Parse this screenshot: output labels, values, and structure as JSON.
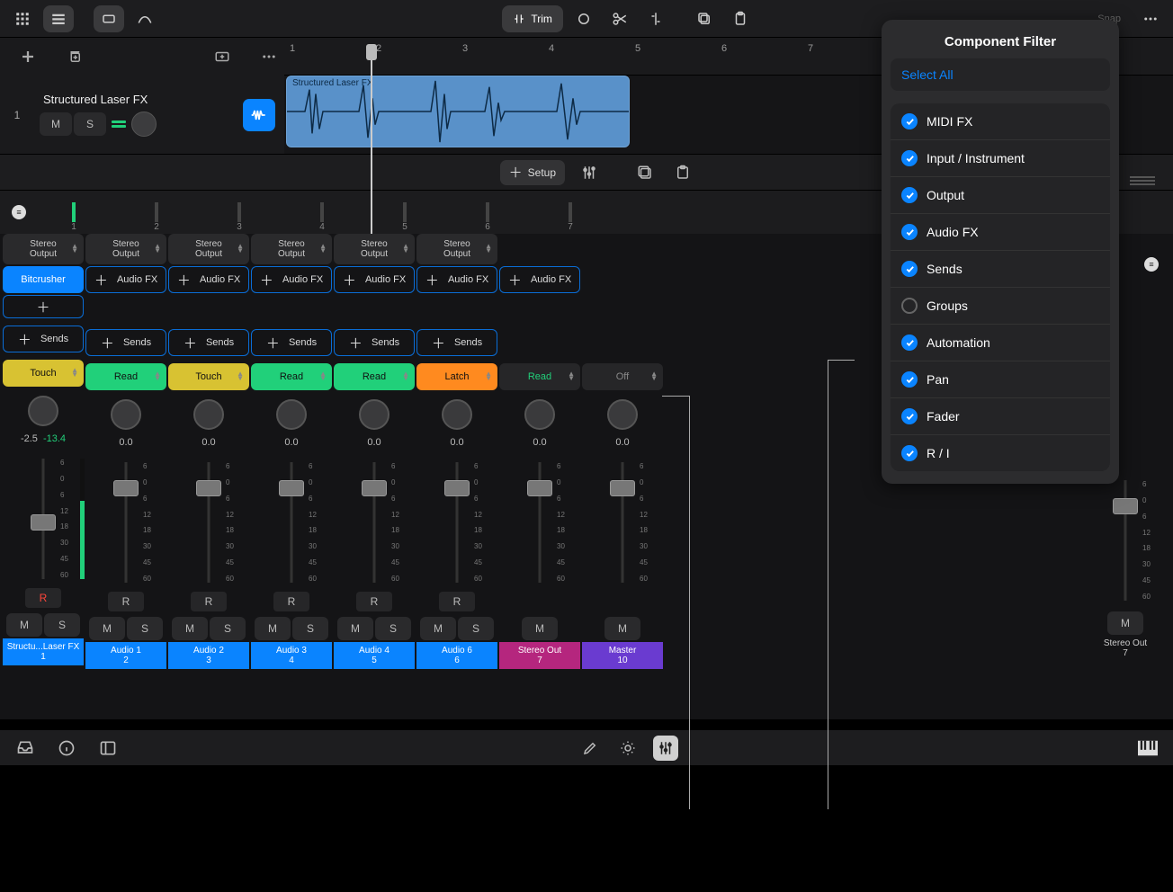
{
  "topbar": {
    "trim": "Trim",
    "snap": "Snap"
  },
  "track": {
    "num": "1",
    "name": "Structured Laser FX",
    "mute": "M",
    "solo": "S",
    "clip_title": "Structured Laser FX"
  },
  "ruler": [
    "1",
    "2",
    "3",
    "4",
    "5",
    "6",
    "7"
  ],
  "midbar": {
    "setup": "Setup"
  },
  "stubs": [
    "1",
    "2",
    "3",
    "4",
    "5",
    "6",
    "7"
  ],
  "ch_labels": {
    "output": "Stereo\nOutput",
    "audiofx": "Audio FX",
    "sends": "Sends",
    "bitcrusher": "Bitcrusher"
  },
  "auto_modes": [
    "Touch",
    "Read",
    "Touch",
    "Read",
    "Read",
    "Latch",
    "Read",
    "Off"
  ],
  "pan_vals": [
    "-2.5 / -13.4",
    "0.0",
    "0.0",
    "0.0",
    "0.0",
    "0.0",
    "0.0",
    "0.0"
  ],
  "fader_scale": [
    "6",
    "0",
    "6",
    "12",
    "18",
    "30",
    "45",
    "60"
  ],
  "mute": "M",
  "solo": "S",
  "rec": "R",
  "ch_names": [
    {
      "l1": "Structu...Laser FX",
      "l2": "1",
      "cls": "ch-blue"
    },
    {
      "l1": "Audio 1",
      "l2": "2",
      "cls": "ch-blue"
    },
    {
      "l1": "Audio 2",
      "l2": "3",
      "cls": "ch-blue"
    },
    {
      "l1": "Audio 3",
      "l2": "4",
      "cls": "ch-blue"
    },
    {
      "l1": "Audio 4",
      "l2": "5",
      "cls": "ch-blue"
    },
    {
      "l1": "Audio 6",
      "l2": "6",
      "cls": "ch-blue"
    },
    {
      "l1": "Stereo Out",
      "l2": "7",
      "cls": "ch-mag"
    },
    {
      "l1": "Master",
      "l2": "10",
      "cls": "ch-pur"
    }
  ],
  "right_strip": {
    "l1": "Stereo Out",
    "l2": "7"
  },
  "popover": {
    "title": "Component Filter",
    "select_all": "Select All",
    "items": [
      {
        "label": "MIDI FX",
        "on": true
      },
      {
        "label": "Input / Instrument",
        "on": true
      },
      {
        "label": "Output",
        "on": true
      },
      {
        "label": "Audio FX",
        "on": true
      },
      {
        "label": "Sends",
        "on": true
      },
      {
        "label": "Groups",
        "on": false
      },
      {
        "label": "Automation",
        "on": true
      },
      {
        "label": "Pan",
        "on": true
      },
      {
        "label": "Fader",
        "on": true
      },
      {
        "label": "R / I",
        "on": true
      }
    ]
  }
}
